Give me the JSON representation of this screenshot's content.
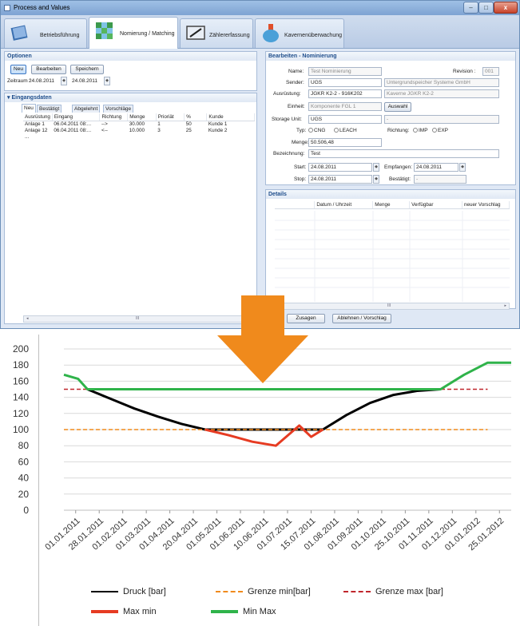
{
  "window": {
    "title": "Process and Values",
    "min_glyph": "‒",
    "max_glyph": "□",
    "close_glyph": "x"
  },
  "tabs": [
    {
      "label": "Betriebsführung",
      "icon": "book-icon"
    },
    {
      "label": "Nomierung / Matching",
      "icon": "data-cube-icon"
    },
    {
      "label": "Zählererfassung",
      "icon": "meter-icon"
    },
    {
      "label": "Kavernenüberwachung",
      "icon": "flask-icon"
    }
  ],
  "options": {
    "title": "Optionen",
    "new_label": "Neu",
    "edit_label": "Bearbeiten",
    "save_label": "Speichern",
    "period_label": "Zeitraum :",
    "period_from": "24.08.2011",
    "period_to": "24.08.2011"
  },
  "input": {
    "title": "▾ Eingangsdaten",
    "tabs": [
      "Neu",
      "Bestätigt",
      "Abgelehnt",
      "Vorschläge"
    ],
    "columns": [
      "Ausrüstung",
      "Eingang",
      "Richtung",
      "Menge",
      "Prioriät",
      "%",
      "Kunde"
    ],
    "rows": [
      [
        "Anlage 1",
        "06.04.2011 08:...",
        "-->",
        "30.000",
        "1",
        "50",
        "Kunde 1"
      ],
      [
        "Anlage 12",
        "06.04.2011 08:...",
        "<--",
        "10.000",
        "3",
        "25",
        "Kunde 2"
      ],
      [
        "...",
        "",
        "",
        "",
        "",
        "",
        ""
      ]
    ],
    "scroll_left": "◂",
    "scroll_mid": "III"
  },
  "edit": {
    "title": "Bearbeiten - Nominierung",
    "name_label": "Name:",
    "name_value": "Test Nominierung",
    "revision_label": "Revision :",
    "revision_value": "001",
    "sender_label": "Sender:",
    "sender_value": "UGS",
    "sender_desc": "Untergrundspeicher Systeme GmbH",
    "equip_label": "Ausrüstung:",
    "equip_value": "JGKR K2-2 - 916K202",
    "equip_desc": "Kaverne JGKR K2-2",
    "unit_label": "Einheit:",
    "unit_value": "Komponente FGL 1",
    "select_label": "Auswahl",
    "storage_label": "Storage Unit:",
    "storage_value": "UGS",
    "storage_desc": "-",
    "type_label": "Typ:",
    "type_opt1": "CNG",
    "type_opt2": "LEACH",
    "direction_label": "Richtung:",
    "dir_opt1": "IMP",
    "dir_opt2": "EXP",
    "amount_label": "Menge:",
    "amount_value": "50.506,48",
    "desc_label": "Bezeichnung:",
    "desc_value": "Test",
    "start_label": "Start:",
    "start_value": "24.08.2011",
    "received_label": "Empfangen:",
    "received_value": "24.08.2011",
    "stop_label": "Stop:",
    "stop_value": "24.08.2011",
    "confirmed_label": "Bestätigt:",
    "confirmed_value": "-"
  },
  "details": {
    "title": "Details",
    "columns": [
      "Datum / Uhrzeit",
      "Menge",
      "Verfügbar",
      "neuer Vorschlag"
    ],
    "accept_label": "Zusagen",
    "reject_label": "Ablehnen / Vorschlag",
    "scroll_mid": "III",
    "scroll_right": "▸"
  },
  "colors": {
    "arrow": "#f08a1c",
    "druck": "#000000",
    "maxmin": "#e63b22",
    "minmax": "#2fb34a",
    "grenze_min": "#f08a1c",
    "grenze_max": "#c0262c"
  },
  "chart_data": {
    "type": "line",
    "ylim": [
      0,
      200
    ],
    "yticks": [
      0,
      20,
      40,
      60,
      80,
      100,
      120,
      140,
      160,
      180,
      200
    ],
    "categories": [
      "01.01.2011",
      "28.01.2011",
      "01.02.2011",
      "01.03.2011",
      "01.04.2011",
      "20.04.2011",
      "01.05.2011",
      "01.06.2011",
      "10.06.2011",
      "01.07.2011",
      "15.07.2011",
      "01.08.2011",
      "01.09.2011",
      "01.10.2011",
      "25.10.2011",
      "01.11.2011",
      "01.12.2011",
      "01.01.2012",
      "25.01.2012"
    ],
    "series": [
      {
        "name": "Druck [bar]",
        "color": "#000000",
        "points": [
          [
            1,
            150
          ],
          [
            2,
            138
          ],
          [
            3,
            126
          ],
          [
            4,
            116
          ],
          [
            5,
            107
          ],
          [
            6,
            100
          ],
          [
            11,
            100
          ],
          [
            12,
            118
          ],
          [
            13,
            133
          ],
          [
            14,
            143
          ],
          [
            15,
            148
          ],
          [
            16,
            150
          ]
        ]
      },
      {
        "name": "Grenze min[bar]",
        "color": "#f08a1c",
        "dashed": true,
        "points": [
          [
            0,
            100
          ],
          [
            18,
            100
          ]
        ]
      },
      {
        "name": "Grenze max [bar]",
        "color": "#c0262c",
        "dashed": true,
        "points": [
          [
            0,
            150
          ],
          [
            18,
            150
          ]
        ]
      },
      {
        "name": "Max min",
        "color": "#e63b22",
        "points": [
          [
            6,
            100
          ],
          [
            7,
            93
          ],
          [
            8,
            85
          ],
          [
            9,
            80
          ],
          [
            10,
            105
          ],
          [
            10.5,
            91
          ],
          [
            11,
            100
          ]
        ]
      },
      {
        "name": "Min Max",
        "color": "#2fb34a",
        "points": [
          [
            0,
            168
          ],
          [
            0.6,
            163
          ],
          [
            1,
            150
          ],
          [
            16,
            150
          ],
          [
            17,
            168
          ],
          [
            18,
            183
          ],
          [
            19,
            183
          ]
        ]
      }
    ],
    "legend_position": "bottom"
  }
}
